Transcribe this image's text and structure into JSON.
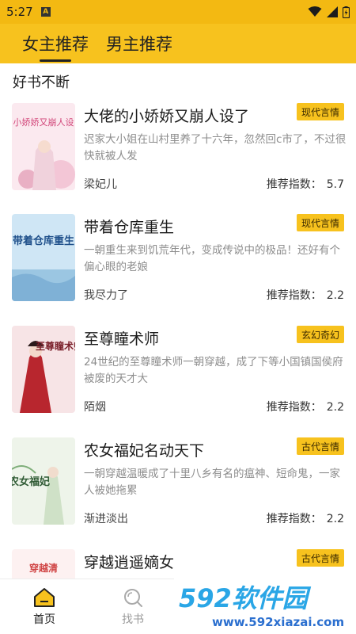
{
  "status": {
    "time": "5:27",
    "a_badge": "A"
  },
  "tabs": [
    {
      "label": "女主推荐",
      "active": true
    },
    {
      "label": "男主推荐",
      "active": false
    }
  ],
  "section_title": "好书不断",
  "score_label": "推荐指数：",
  "books": [
    {
      "title": "大佬的小娇娇又崩人设了",
      "tag": "现代言情",
      "desc": "迟家大小姐在山村里养了十六年，忽然回c市了，不过很快就被人发",
      "author": "梁妃儿",
      "score": "5.7",
      "cover_text": "小娇娇又崩人设"
    },
    {
      "title": "带着仓库重生",
      "tag": "现代言情",
      "desc": "一朝重生来到饥荒年代，变成传说中的极品！还好有个偏心眼的老娘",
      "author": "我尽力了",
      "score": "2.2",
      "cover_text": "带着仓库重生"
    },
    {
      "title": "至尊瞳术师",
      "tag": "玄幻奇幻",
      "desc": "24世纪的至尊瞳术师一朝穿越，成了下等小国镇国侯府被废的天才大",
      "author": "陌烟",
      "score": "2.2",
      "cover_text": "至尊瞳术师"
    },
    {
      "title": "农女福妃名动天下",
      "tag": "古代言情",
      "desc": "一朝穿越温暖成了十里八乡有名的瘟神、短命鬼，一家人被她拖累",
      "author": "渐进淡出",
      "score": "2.2",
      "cover_text": "农女福妃"
    },
    {
      "title": "穿越逍遥嫡女",
      "tag": "古代言情",
      "desc": "",
      "author": "",
      "score": "",
      "cover_text": "穿越清"
    }
  ],
  "nav": [
    {
      "label": "首页",
      "icon": "home-icon",
      "active": true
    },
    {
      "label": "找书",
      "icon": "search-icon",
      "active": false
    }
  ],
  "watermark": {
    "brand": "592软件园",
    "url": "www.592xiazai.com"
  },
  "colors": {
    "accent": "#f7c21e",
    "status_bar": "#f3b912",
    "badge_text": "#3b2a00",
    "desc_gray": "#8d8d8d"
  }
}
